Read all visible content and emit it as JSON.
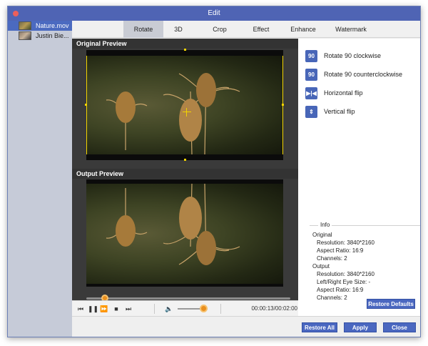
{
  "window": {
    "title": "Edit"
  },
  "files": [
    {
      "name": "Nature.mov",
      "selected": true
    },
    {
      "name": "Justin Bie...",
      "selected": false
    }
  ],
  "tabs": [
    {
      "label": "Rotate",
      "active": true
    },
    {
      "label": "3D"
    },
    {
      "label": "Crop"
    },
    {
      "label": "Effect"
    },
    {
      "label": "Enhance"
    },
    {
      "label": "Watermark"
    }
  ],
  "preview": {
    "original_label": "Original Preview",
    "output_label": "Output Preview"
  },
  "playback": {
    "time": "00:00:13/00:02:00",
    "seek_fraction": 0.09,
    "volume_fraction": 0.85
  },
  "actions": [
    {
      "label": "Rotate 90 clockwise",
      "icon": "rotate-cw-icon"
    },
    {
      "label": "Rotate 90 counterclockwise",
      "icon": "rotate-ccw-icon"
    },
    {
      "label": "Horizontal flip",
      "icon": "flip-horizontal-icon"
    },
    {
      "label": "Vertical flip",
      "icon": "flip-vertical-icon"
    }
  ],
  "info": {
    "title": "Info",
    "original_heading": "Original",
    "original": {
      "resolution": "Resolution: 3840*2160",
      "aspect": "Aspect Ratio: 16:9",
      "channels": "Channels: 2"
    },
    "output_heading": "Output",
    "output": {
      "resolution": "Resolution: 3840*2160",
      "eye_size": "Left/Right Eye Size: -",
      "aspect": "Aspect Ratio: 16:9",
      "channels": "Channels: 2"
    }
  },
  "buttons": {
    "restore_defaults": "Restore Defaults",
    "restore_all": "Restore All",
    "apply": "Apply",
    "close": "Close"
  },
  "colors": {
    "accent": "#4a67c0",
    "titlebar": "#4f64b4",
    "knob": "#e98f1e",
    "selection": "#f2d300"
  }
}
